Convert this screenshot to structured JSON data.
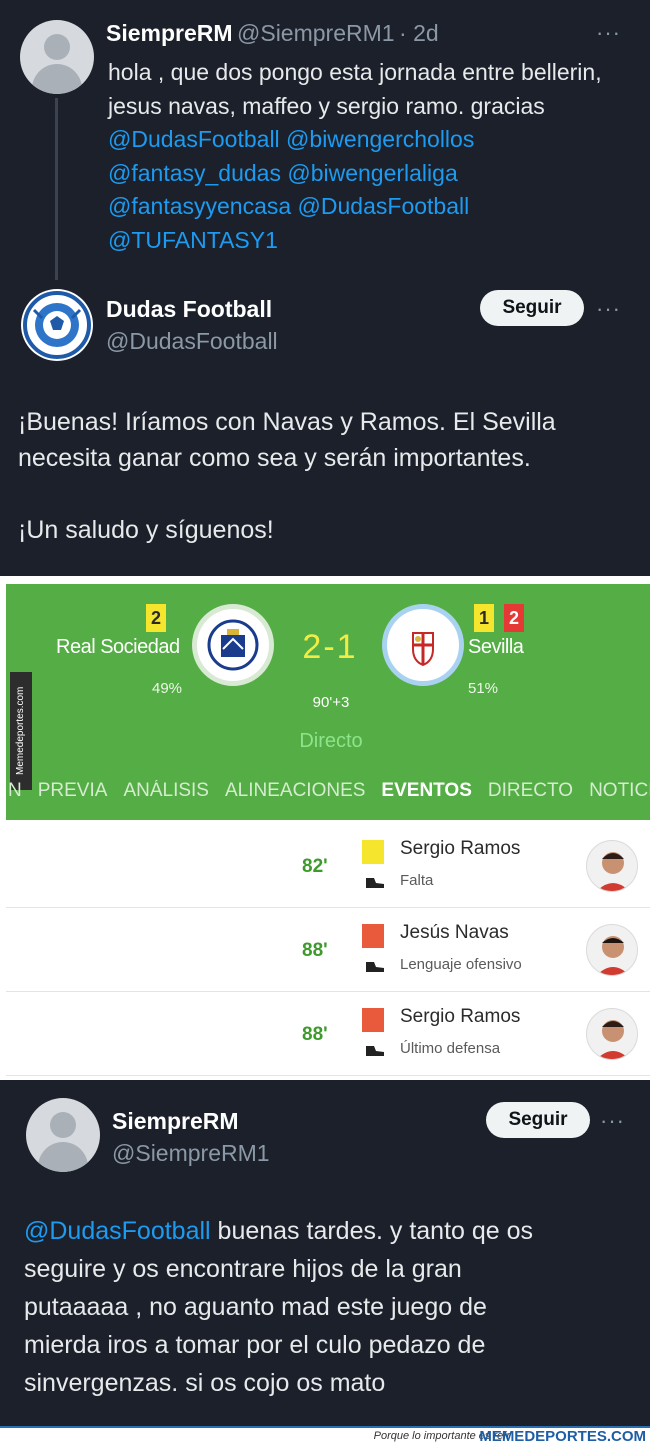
{
  "tweet1": {
    "name": "SiempreRM",
    "handle": "@SiempreRM1",
    "time": "· 2d",
    "more": "···",
    "text_line1": "hola , que dos pongo esta jornada entre bellerin,",
    "text_line2": "jesus navas, maffeo y sergio ramo. gracias",
    "mentions": [
      "@DudasFootball @biwengerchollos",
      "@fantasy_dudas @biwengerlaliga",
      "@fantasyyencasa @DudasFootball",
      "@TUFANTASY1"
    ]
  },
  "tweet2": {
    "name": "Dudas Football",
    "handle": "@DudasFootball",
    "follow_label": "Seguir",
    "more": "···",
    "text_line1": "¡Buenas! Iríamos con Navas y Ramos. El Sevilla",
    "text_line2": "necesita ganar como sea y serán importantes.",
    "text_line3": "¡Un saludo y síguenos!"
  },
  "match": {
    "home_team": "Real Sociedad",
    "home_yellow": "2",
    "home_pct": "49%",
    "score": "2-1",
    "minute": "90'+3",
    "status": "Directo",
    "away_team": "Sevilla",
    "away_yellow": "1",
    "away_red": "2",
    "away_pct": "51%",
    "side_watermark": "Memedeportes.com",
    "tabs": [
      "N",
      "PREVIA",
      "ANÁLISIS",
      "ALINEACIONES",
      "EVENTOS",
      "DIRECTO",
      "NOTICIAS"
    ],
    "active_tab": "EVENTOS",
    "events": [
      {
        "minute": "82'",
        "card": "yellow",
        "player": "Sergio Ramos",
        "reason": "Falta"
      },
      {
        "minute": "88'",
        "card": "red",
        "player": "Jesús Navas",
        "reason": "Lenguaje ofensivo"
      },
      {
        "minute": "88'",
        "card": "red",
        "player": "Sergio Ramos",
        "reason": "Último defensa"
      }
    ],
    "colors": {
      "pitch": "#55ad45",
      "yellow_card": "#f5e52c",
      "red_card": "#e53935",
      "score": "#f3ec45"
    }
  },
  "tweet3": {
    "name": "SiempreRM",
    "handle": "@SiempreRM1",
    "follow_label": "Seguir",
    "more": "···",
    "mention": "@DudasFootball",
    "text_line1_rest": " buenas tardes. y tanto qe os",
    "text_line2": "seguire y os encontrare hijos de la gran",
    "text_line3": "putaaaaa , no aguanto mad este juego de",
    "text_line4": "mierda iros a tomar por el culo pedazo de",
    "text_line5": "sinvergenzas. si os cojo os mato"
  },
  "footer": {
    "tagline": "Porque lo importante es reír",
    "brand": "MEMEDEPORTES.COM"
  }
}
